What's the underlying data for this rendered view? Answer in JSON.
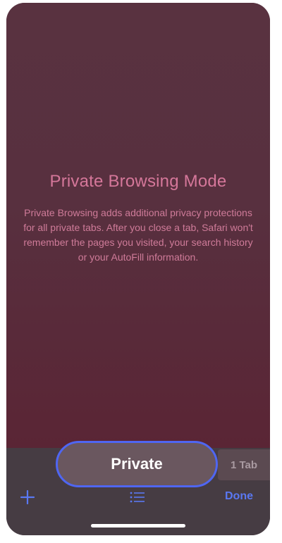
{
  "private_browsing": {
    "title": "Private Browsing Mode",
    "description": "Private Browsing adds additional privacy protections for all private tabs. After you close a tab, Safari won't remember the pages you visited, your search history or your AutoFill information."
  },
  "tab_group": {
    "selected_label": "Private",
    "count_label": "1 Tab"
  },
  "toolbar": {
    "done_label": "Done",
    "add_icon": "plus-icon",
    "list_icon": "list-icon"
  },
  "colors": {
    "accent": "#4f66f2",
    "title_pink": "#d5779a",
    "background": "#593240"
  }
}
